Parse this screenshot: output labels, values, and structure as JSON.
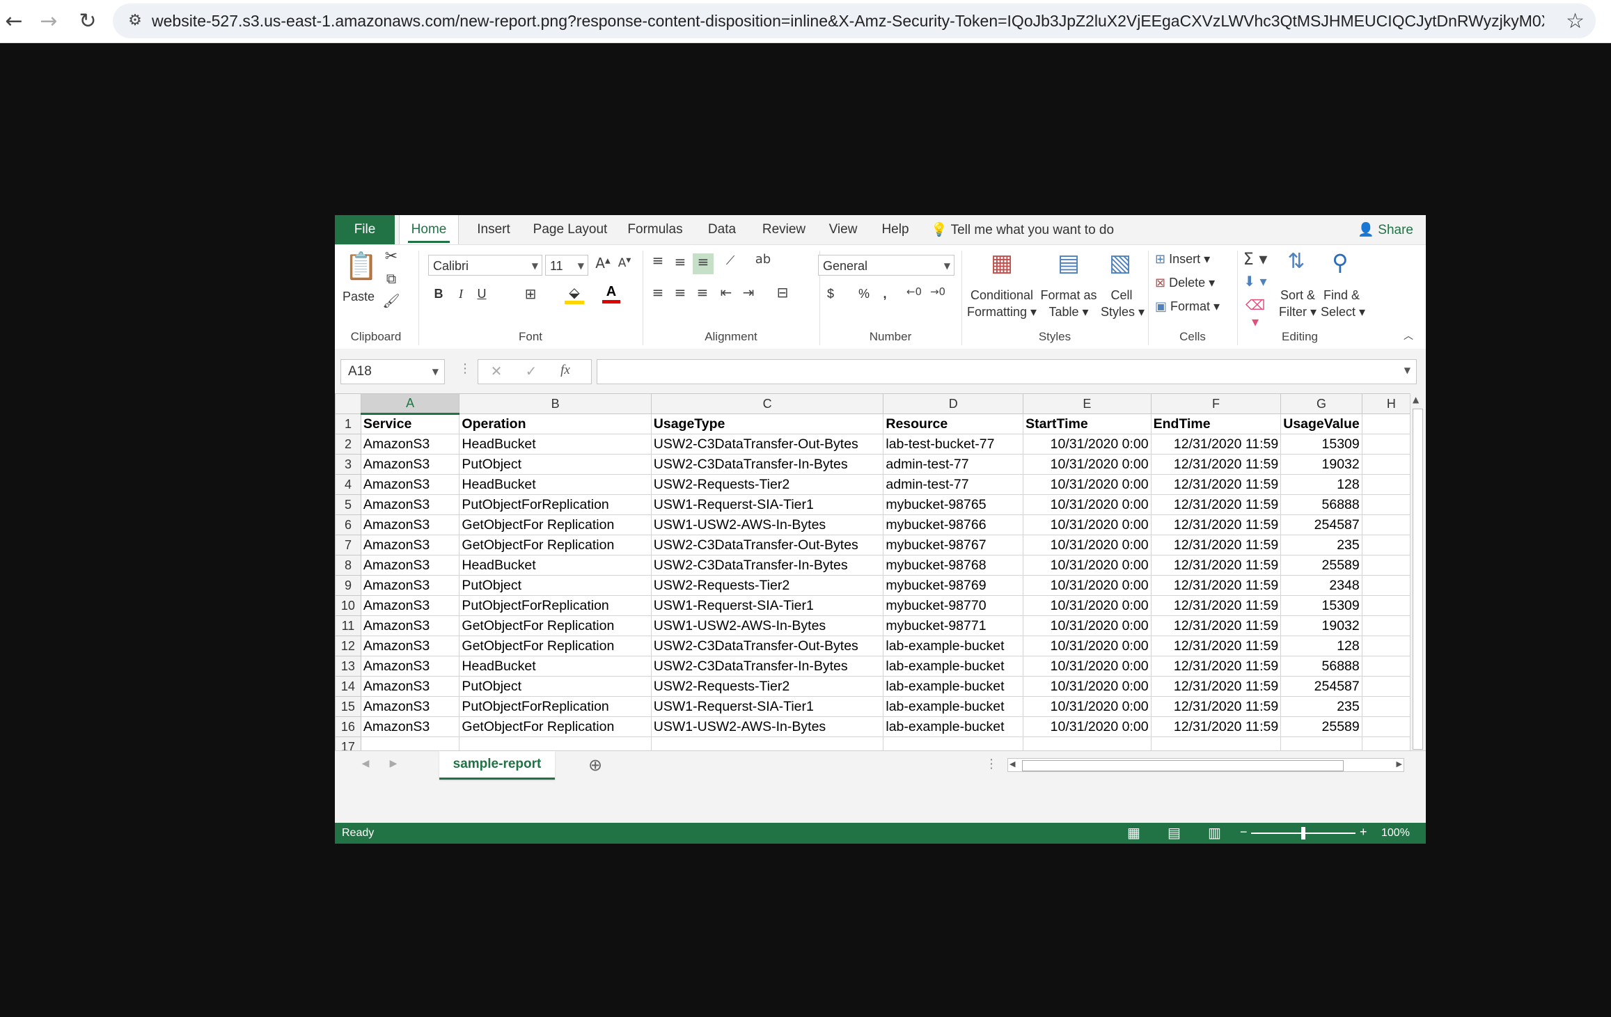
{
  "browser": {
    "url": "website-527.s3.us-east-1.amazonaws.com/new-report.png?response-content-disposition=inline&X-Amz-Security-Token=IQoJb3JpZ2luX2VjEEgaCXVzLWVhc3QtMSJHMEUCIQCJytDnRWyzjkyM0X24Bu5bNRSXw4gH...",
    "back_icon": "back-arrow-icon",
    "forward_icon": "forward-arrow-icon",
    "reload_icon": "reload-icon",
    "site_info_icon": "site-info-icon",
    "bookmark_icon": "star-icon"
  },
  "ribbon_tabs": [
    "File",
    "Home",
    "Insert",
    "Page Layout",
    "Formulas",
    "Data",
    "Review",
    "View",
    "Help"
  ],
  "tell_me": "Tell me what you want to do",
  "share": "Share",
  "clipboard": {
    "paste": "Paste",
    "label": "Clipboard"
  },
  "font": {
    "name": "Calibri",
    "size": "11",
    "label": "Font",
    "bold": "B",
    "italic": "I",
    "underline": "U"
  },
  "alignment": {
    "label": "Alignment"
  },
  "number": {
    "format": "General",
    "label": "Number",
    "currency": "$",
    "percent": "%",
    "comma": ","
  },
  "styles": {
    "conditional": [
      "Conditional",
      "Formatting"
    ],
    "format_table": [
      "Format as",
      "Table"
    ],
    "cell_styles": [
      "Cell",
      "Styles"
    ],
    "label": "Styles"
  },
  "cells": {
    "insert": "Insert",
    "delete": "Delete",
    "format": "Format",
    "label": "Cells"
  },
  "editing": {
    "sort": [
      "Sort &",
      "Filter"
    ],
    "find": [
      "Find &",
      "Select"
    ],
    "label": "Editing"
  },
  "formula_bar": {
    "name_box": "A18",
    "fx": "fx",
    "value": ""
  },
  "columns": [
    "A",
    "B",
    "C",
    "D",
    "E",
    "F",
    "G",
    "H"
  ],
  "rows": [
    [
      "Service",
      "Operation",
      "UsageType",
      "Resource",
      "StartTime",
      "EndTime",
      "UsageValue",
      ""
    ],
    [
      "AmazonS3",
      "HeadBucket",
      "USW2-C3DataTransfer-Out-Bytes",
      "lab-test-bucket-77",
      "10/31/2020 0:00",
      "12/31/2020 11:59",
      "15309",
      ""
    ],
    [
      "AmazonS3",
      "PutObject",
      "USW2-C3DataTransfer-In-Bytes",
      "admin-test-77",
      "10/31/2020 0:00",
      "12/31/2020 11:59",
      "19032",
      ""
    ],
    [
      "AmazonS3",
      "HeadBucket",
      "USW2-Requests-Tier2",
      "admin-test-77",
      "10/31/2020 0:00",
      "12/31/2020 11:59",
      "128",
      ""
    ],
    [
      "AmazonS3",
      "PutObjectForReplication",
      "USW1-Requerst-SIA-Tier1",
      "mybucket-98765",
      "10/31/2020 0:00",
      "12/31/2020 11:59",
      "56888",
      ""
    ],
    [
      "AmazonS3",
      "GetObjectFor Replication",
      "USW1-USW2-AWS-In-Bytes",
      "mybucket-98766",
      "10/31/2020 0:00",
      "12/31/2020 11:59",
      "254587",
      ""
    ],
    [
      "AmazonS3",
      "GetObjectFor Replication",
      "USW2-C3DataTransfer-Out-Bytes",
      "mybucket-98767",
      "10/31/2020 0:00",
      "12/31/2020 11:59",
      "235",
      ""
    ],
    [
      "AmazonS3",
      "HeadBucket",
      "USW2-C3DataTransfer-In-Bytes",
      "mybucket-98768",
      "10/31/2020 0:00",
      "12/31/2020 11:59",
      "25589",
      ""
    ],
    [
      "AmazonS3",
      "PutObject",
      "USW2-Requests-Tier2",
      "mybucket-98769",
      "10/31/2020 0:00",
      "12/31/2020 11:59",
      "2348",
      ""
    ],
    [
      "AmazonS3",
      "PutObjectForReplication",
      "USW1-Requerst-SIA-Tier1",
      "mybucket-98770",
      "10/31/2020 0:00",
      "12/31/2020 11:59",
      "15309",
      ""
    ],
    [
      "AmazonS3",
      "GetObjectFor Replication",
      "USW1-USW2-AWS-In-Bytes",
      "mybucket-98771",
      "10/31/2020 0:00",
      "12/31/2020 11:59",
      "19032",
      ""
    ],
    [
      "AmazonS3",
      "GetObjectFor Replication",
      "USW2-C3DataTransfer-Out-Bytes",
      "lab-example-bucket",
      "10/31/2020 0:00",
      "12/31/2020 11:59",
      "128",
      ""
    ],
    [
      "AmazonS3",
      "HeadBucket",
      "USW2-C3DataTransfer-In-Bytes",
      "lab-example-bucket",
      "10/31/2020 0:00",
      "12/31/2020 11:59",
      "56888",
      ""
    ],
    [
      "AmazonS3",
      "PutObject",
      "USW2-Requests-Tier2",
      "lab-example-bucket",
      "10/31/2020 0:00",
      "12/31/2020 11:59",
      "254587",
      ""
    ],
    [
      "AmazonS3",
      "PutObjectForReplication",
      "USW1-Requerst-SIA-Tier1",
      "lab-example-bucket",
      "10/31/2020 0:00",
      "12/31/2020 11:59",
      "235",
      ""
    ],
    [
      "AmazonS3",
      "GetObjectFor Replication",
      "USW1-USW2-AWS-In-Bytes",
      "lab-example-bucket",
      "10/31/2020 0:00",
      "12/31/2020 11:59",
      "25589",
      ""
    ],
    [
      "",
      "",
      "",
      "",
      "",
      "",
      "",
      ""
    ],
    [
      "",
      "",
      "",
      "",
      "",
      "",
      "",
      ""
    ]
  ],
  "sheet_tab": "sample-report",
  "status": {
    "ready": "Ready",
    "zoom": "100%"
  },
  "colors": {
    "accent": "#217346"
  }
}
